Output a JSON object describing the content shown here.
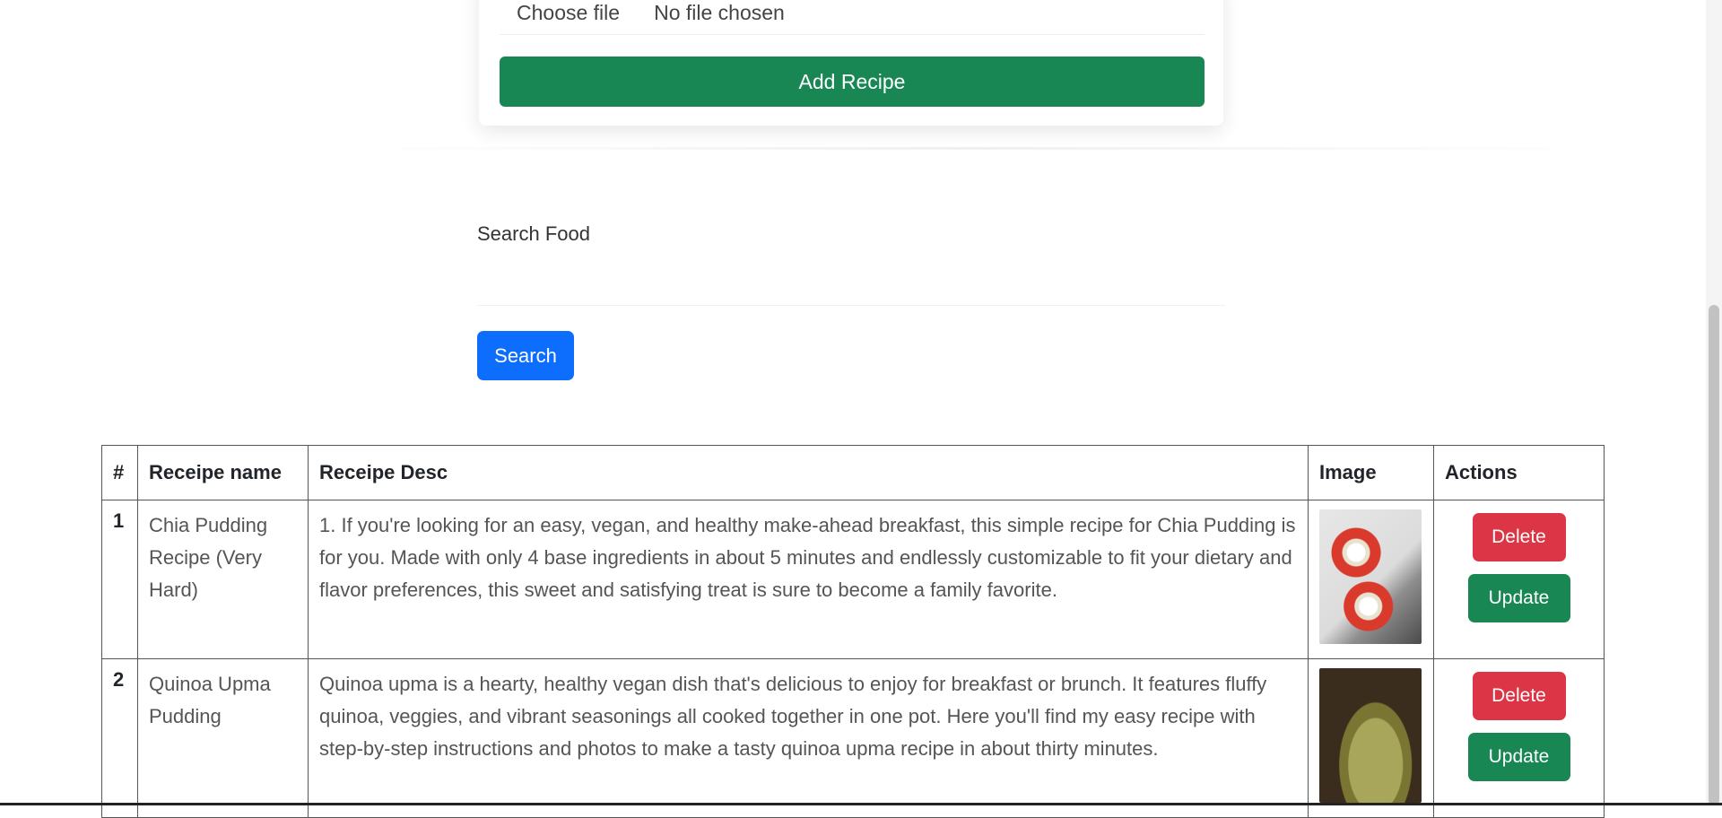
{
  "form": {
    "choose_file_label": "Choose file",
    "no_file_text": "No file chosen",
    "add_recipe_label": "Add Recipe"
  },
  "search": {
    "label": "Search Food",
    "value": "",
    "button_label": "Search"
  },
  "table": {
    "headers": [
      "#",
      "Receipe name",
      "Receipe Desc",
      "Image",
      "Actions"
    ],
    "rows": [
      {
        "num": "1",
        "name": "Chia Pudding Recipe (Very Hard)",
        "desc": "1. If you're looking for an easy, vegan, and healthy make-ahead breakfast, this simple recipe for Chia Pudding is for you. Made with only 4 base ingredients in about 5 minutes and endlessly customizable to fit your dietary and flavor preferences, this sweet and satisfying treat is sure to become a family favorite.",
        "image": "chia-pudding-photo",
        "delete_label": "Delete",
        "update_label": "Update"
      },
      {
        "num": "2",
        "name": "Quinoa Upma Pudding",
        "desc": "Quinoa upma is a hearty, healthy vegan dish that's delicious to enjoy for breakfast or brunch. It features fluffy quinoa, veggies, and vibrant seasonings all cooked together in one pot. Here you'll find my easy recipe with step-by-step instructions and photos to make a tasty quinoa upma recipe in about thirty minutes.",
        "image": "quinoa-upma-photo",
        "delete_label": "Delete",
        "update_label": "Update"
      }
    ]
  },
  "colors": {
    "success": "#198754",
    "primary": "#0d6efd",
    "danger": "#dc3545"
  }
}
